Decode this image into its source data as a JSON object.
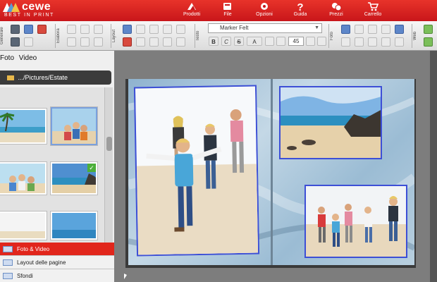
{
  "app": {
    "brand": "cewe",
    "tagline": "BEST IN PRINT"
  },
  "topnav": [
    {
      "label": "Prodotti",
      "icon": "products-icon"
    },
    {
      "label": "File",
      "icon": "file-icon"
    },
    {
      "label": "Opzioni",
      "icon": "options-icon"
    },
    {
      "label": "Guida",
      "icon": "help-icon"
    },
    {
      "label": "Prezzi",
      "icon": "prices-icon"
    },
    {
      "label": "Carrello",
      "icon": "cart-icon"
    }
  ],
  "toolbar": {
    "groups": [
      "Generale",
      "Elabora",
      "Layout",
      "Testo",
      "Foto",
      "Web"
    ],
    "font_name": "Marker Felt",
    "font_size": "45",
    "format_buttons": [
      "B",
      "C",
      "S",
      "A"
    ]
  },
  "left_panel": {
    "tabs": [
      "Foto",
      "Video"
    ],
    "path": ".../Pictures/Estate",
    "bottom_tabs": [
      "Foto & Video",
      "Layout delle pagine",
      "Sfondi"
    ]
  },
  "colors": {
    "brand_red": "#e1261c",
    "photo_frame": "#3d4fd6",
    "selection_blue": "#7aa0dd"
  }
}
